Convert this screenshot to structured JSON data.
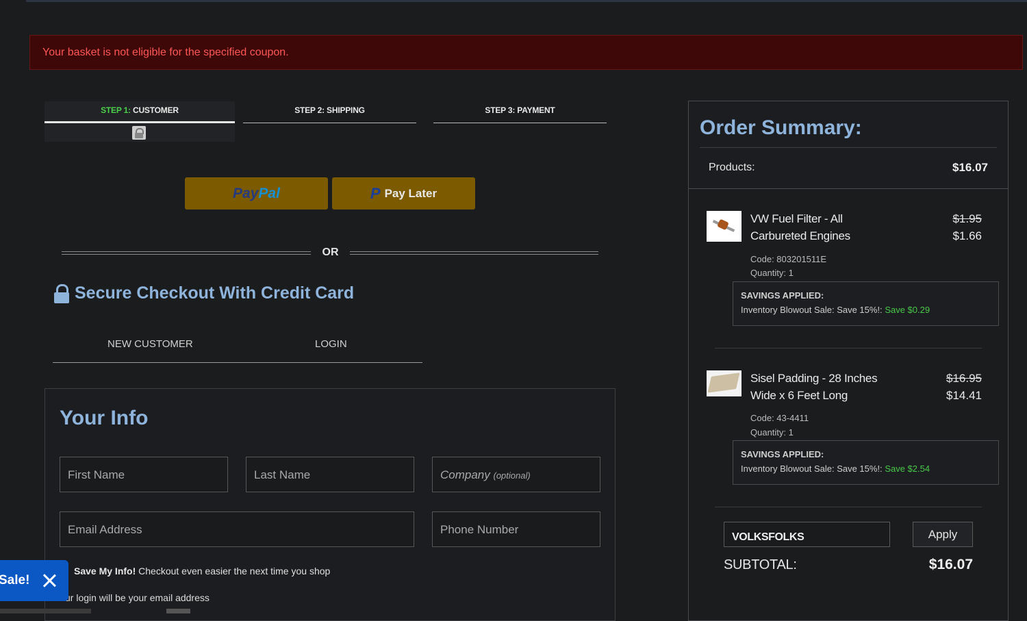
{
  "alert": {
    "message": "Your basket is not eligible for the specified coupon."
  },
  "steps": {
    "step1_prefix": "STEP 1:",
    "step1_label": "CUSTOMER",
    "step2": "STEP 2: SHIPPING",
    "step3": "STEP 3: PAYMENT"
  },
  "paypal": {
    "word_a": "Pay",
    "word_b": "Pal",
    "later_icon": "P",
    "later_label": "Pay Later"
  },
  "divider": {
    "or": "OR"
  },
  "secure": {
    "title": "Secure Checkout With Credit Card"
  },
  "customer_tabs": {
    "new": "NEW CUSTOMER",
    "login": "LOGIN"
  },
  "your_info": {
    "title": "Your Info",
    "first_name": "First Name",
    "last_name": "Last Name",
    "company": "Company",
    "company_hint": "(optional)",
    "email": "Email Address",
    "phone": "Phone Number",
    "save_bold": "Save My Info!",
    "save_text": "Checkout even easier the next time you shop",
    "login_note": "ur login will be your email address"
  },
  "sale_badge": {
    "label": "Sale!"
  },
  "summary": {
    "title": "Order Summary:",
    "products_label": "Products:",
    "products_value": "$16.07",
    "items": [
      {
        "name": "VW Fuel Filter - All Carbureted Engines",
        "price_old": "$1.95",
        "price_new": "$1.66",
        "code": "Code: 803201511E",
        "quantity": "Quantity: 1",
        "savings_head": "SAVINGS APPLIED:",
        "savings_text": "Inventory Blowout Sale: Save 15%!:",
        "savings_amount": "Save $0.29"
      },
      {
        "name": "Sisel Padding - 28 Inches Wide x 6 Feet Long",
        "price_old": "$16.95",
        "price_new": "$14.41",
        "code": "Code: 43-4411",
        "quantity": "Quantity: 1",
        "savings_head": "SAVINGS APPLIED:",
        "savings_text": "Inventory Blowout Sale: Save 15%!:",
        "savings_amount": "Save $2.54"
      }
    ],
    "coupon_value": "VOLKSFOLKS",
    "apply_label": "Apply",
    "subtotal_label": "SUBTOTAL:",
    "subtotal_value": "$16.07"
  }
}
